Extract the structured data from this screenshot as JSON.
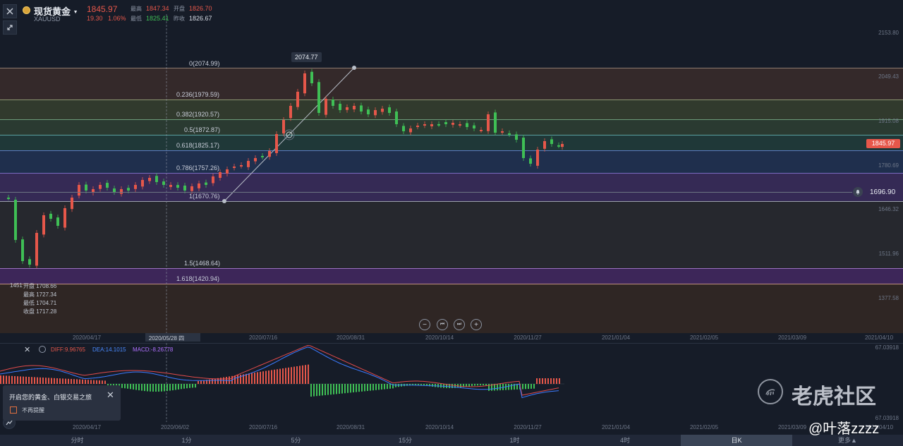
{
  "header": {
    "title": "现货黄金",
    "symbol": "XAUUSD",
    "price": "1845.97",
    "change": "19.30",
    "change_pct": "1.06%",
    "high_label": "最高",
    "high": "1847.34",
    "open_label": "开盘",
    "open": "1826.70",
    "low_label": "最低",
    "low": "1825.41",
    "prev_close_label": "昨收",
    "prev_close": "1826.67"
  },
  "fib_levels": [
    {
      "label": "0(2074.99)"
    },
    {
      "label": "0.236(1979.59)"
    },
    {
      "label": "0.382(1920.57)"
    },
    {
      "label": "0.5(1872.87)"
    },
    {
      "label": "0.618(1825.17)"
    },
    {
      "label": "0.786(1757.26)"
    },
    {
      "label": "1(1670.76)"
    },
    {
      "label": "1.5(1468.64)"
    },
    {
      "label": "1.618(1420.94)"
    }
  ],
  "price_axis": [
    "2153.80",
    "2049.43",
    "1915.08",
    "1780.69",
    "1646.32",
    "1511.96",
    "1377.58"
  ],
  "current_price_tag": "1845.97",
  "alert_price": "1696.90",
  "peak_label": "2074.77",
  "low_label_left": "1451",
  "ohlc_panel": {
    "open": "开盘 1708.66",
    "high": "最高 1727.34",
    "low": "最低 1704.71",
    "close": "收盘 1717.28"
  },
  "x_axis_main": [
    "2020/04/17",
    "2020/05/28 四",
    "2020/07/16",
    "2020/08/31",
    "2020/10/14",
    "2020/11/27",
    "2021/01/04",
    "2021/02/05",
    "2021/03/09",
    "2021/04/10"
  ],
  "x_axis_macd": [
    "2020/04/17",
    "2020/06/02",
    "2020/07/16",
    "2020/08/31",
    "2020/10/14",
    "2020/11/27",
    "2021/01/04",
    "2021/02/05",
    "2021/03/09",
    "2021/04/10"
  ],
  "macd": {
    "diff": "DIFF:9.96765",
    "dea": "DEA:14.1015",
    "macd": "MACD:-8.26778",
    "top_value": "67.03918",
    "bottom_value": "67.03918"
  },
  "notice": {
    "title": "开启您的黄金、白银交易之旅",
    "checkbox_label": "不再提醒"
  },
  "timeframes": [
    "分时",
    "1分",
    "5分",
    "15分",
    "1时",
    "4时",
    "日K",
    "更多▲"
  ],
  "watermark": {
    "brand": "老虎社区",
    "user": "@叶落zzzz"
  },
  "colors": {
    "up": "#e6574a",
    "down": "#3fbf55",
    "background": "#161c28",
    "diff_line": "#e14b4b",
    "dea_line": "#3b7bff"
  },
  "icons": {
    "close": "close-icon",
    "expand": "expand-icon",
    "coin": "gold-coin-icon",
    "bell": "bell-icon",
    "zoom_out": "zoom-out-icon",
    "zoom_in": "zoom-in-icon",
    "prev": "skip-back-icon",
    "next": "skip-forward-icon",
    "settings": "settings-icon",
    "indicator": "indicator-icon"
  }
}
